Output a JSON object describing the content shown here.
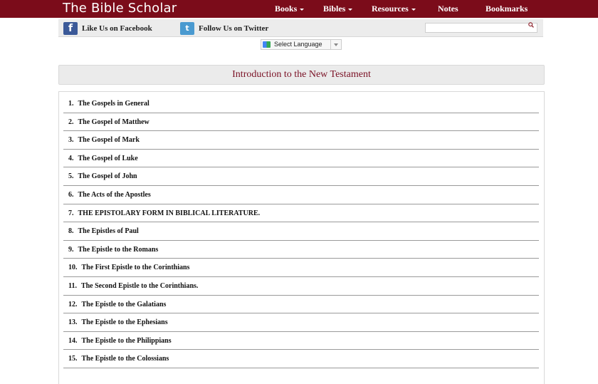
{
  "header": {
    "brand": "The Bible Scholar",
    "nav": [
      {
        "label": "Books",
        "dropdown": true
      },
      {
        "label": "Bibles",
        "dropdown": true
      },
      {
        "label": "Resources",
        "dropdown": true
      },
      {
        "label": "Notes",
        "dropdown": false
      },
      {
        "label": "Bookmarks",
        "dropdown": false
      }
    ]
  },
  "social": {
    "facebook_label": "Like Us on Facebook",
    "twitter_label": "Follow Us on Twitter",
    "facebook_icon": "f",
    "twitter_icon": "t"
  },
  "search": {
    "value": "",
    "placeholder": ""
  },
  "language": {
    "label": "Select Language"
  },
  "page": {
    "title": "Introduction to the New Testament"
  },
  "chapters": [
    {
      "num": "1.",
      "title": "The Gospels in General"
    },
    {
      "num": "2.",
      "title": "The Gospel of Matthew"
    },
    {
      "num": "3.",
      "title": "The Gospel of Mark"
    },
    {
      "num": "4.",
      "title": "The Gospel of Luke"
    },
    {
      "num": "5.",
      "title": "The Gospel of John"
    },
    {
      "num": "6.",
      "title": "The Acts of the Apostles"
    },
    {
      "num": "7.",
      "title": "THE EPISTOLARY FORM IN BIBLICAL LITERATURE."
    },
    {
      "num": "8.",
      "title": "The Epistles of Paul"
    },
    {
      "num": "9.",
      "title": "The Epistle to the Romans"
    },
    {
      "num": "10.",
      "title": "The First Epistle to the Corinthians"
    },
    {
      "num": "11.",
      "title": "The Second Epistle to the Corinthians."
    },
    {
      "num": "12.",
      "title": "The Epistle to the Galatians"
    },
    {
      "num": "13.",
      "title": "The Epistle to the Ephesians"
    },
    {
      "num": "14.",
      "title": "The Epistle to the Philippians"
    },
    {
      "num": "15.",
      "title": "The Epistle to the Colossians"
    }
  ],
  "colors": {
    "brand": "#7b0c1a",
    "title": "#7a1024"
  }
}
